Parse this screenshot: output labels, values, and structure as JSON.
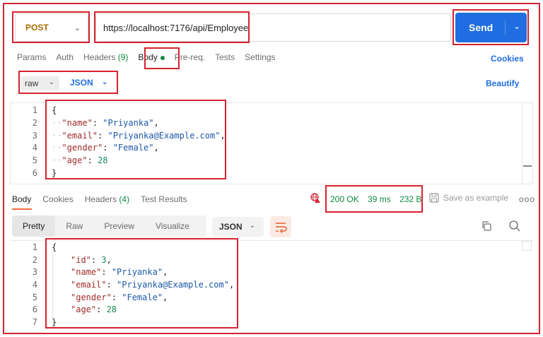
{
  "request": {
    "method": "POST",
    "url": "https://localhost:7176/api/Employee",
    "send_label": "Send"
  },
  "request_tabs": {
    "params": "Params",
    "auth": "Auth",
    "headers": "Headers",
    "headers_count": "(9)",
    "body": "Body",
    "prereq": "Pre-req.",
    "tests": "Tests",
    "settings": "Settings",
    "cookies": "Cookies"
  },
  "body_type": {
    "mode": "raw",
    "language": "JSON",
    "beautify": "Beautify"
  },
  "request_body": {
    "line_numbers": [
      "1",
      "2",
      "3",
      "4",
      "5",
      "6"
    ],
    "open_brace": "{",
    "close_brace": "}",
    "fields": [
      {
        "key": "\"name\"",
        "value": "\"Priyanka\"",
        "comma": ","
      },
      {
        "key": "\"email\"",
        "value": "\"Priyanka@Example.com\"",
        "comma": ","
      },
      {
        "key": "\"gender\"",
        "value": "\"Female\"",
        "comma": ","
      },
      {
        "key": "\"age\"",
        "value": "28",
        "comma": ""
      }
    ]
  },
  "response_tabs": {
    "body": "Body",
    "cookies": "Cookies",
    "headers": "Headers",
    "headers_count": "(4)",
    "test_results": "Test Results"
  },
  "response_status": {
    "code": "200 OK",
    "time": "39 ms",
    "size": "232 B",
    "save_example": "Save as example",
    "more": "ooo"
  },
  "response_view": {
    "pretty": "Pretty",
    "raw": "Raw",
    "preview": "Preview",
    "visualize": "Visualize",
    "format": "JSON"
  },
  "response_body": {
    "line_numbers": [
      "1",
      "2",
      "3",
      "4",
      "5",
      "6",
      "7"
    ],
    "open_brace": "{",
    "close_brace": "}",
    "fields": [
      {
        "key": "\"id\"",
        "value": "3",
        "comma": ","
      },
      {
        "key": "\"name\"",
        "value": "\"Priyanka\"",
        "comma": ","
      },
      {
        "key": "\"email\"",
        "value": "\"Priyanka@Example.com\"",
        "comma": ","
      },
      {
        "key": "\"gender\"",
        "value": "\"Female\"",
        "comma": ","
      },
      {
        "key": "\"age\"",
        "value": "28",
        "comma": ""
      }
    ]
  },
  "colors": {
    "accent": "#1f6de0",
    "status_ok": "#0d8a3f",
    "highlight_box": "#d6222f",
    "method": "#a86d00"
  }
}
